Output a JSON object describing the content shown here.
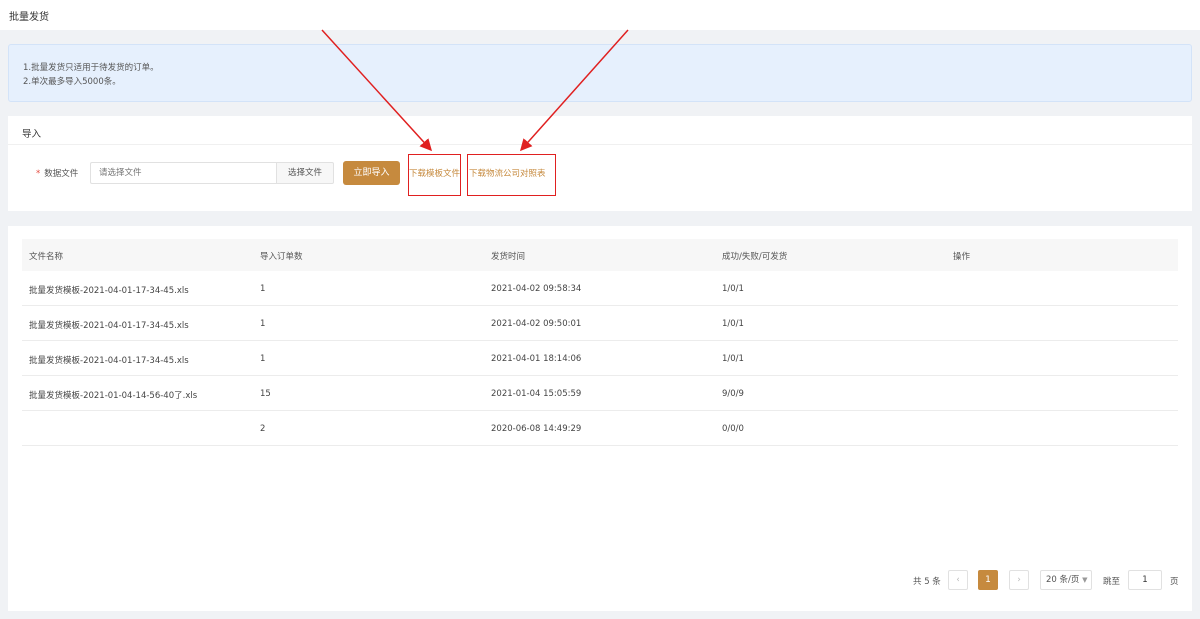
{
  "header": {
    "title": "批量发货"
  },
  "notice": {
    "lines": [
      "1.批量发货只适用于待发货的订单。",
      "2.单次最多导入5000条。"
    ]
  },
  "import": {
    "section_title": "导入",
    "required_mark": "*",
    "file_label": "数据文件",
    "file_placeholder": "请选择文件",
    "choose_file_label": "选择文件",
    "import_button_label": "立即导入",
    "download_template_label": "下载模板文件",
    "download_logistics_label": "下载物流公司对照表"
  },
  "table": {
    "headers": [
      "文件名称",
      "导入订单数",
      "发货时间",
      "成功/失败/可发货",
      "操作"
    ],
    "rows": [
      [
        "批量发货模板-2021-04-01-17-34-45.xls",
        "1",
        "2021-04-02 09:58:34",
        "1/0/1",
        ""
      ],
      [
        "批量发货模板-2021-04-01-17-34-45.xls",
        "1",
        "2021-04-02 09:50:01",
        "1/0/1",
        ""
      ],
      [
        "批量发货模板-2021-04-01-17-34-45.xls",
        "1",
        "2021-04-01 18:14:06",
        "1/0/1",
        ""
      ],
      [
        "批量发货模板-2021-01-04-14-56-40了.xls",
        "15",
        "2021-01-04 15:05:59",
        "9/0/9",
        ""
      ],
      [
        "",
        "2",
        "2020-06-08 14:49:29",
        "0/0/0",
        ""
      ]
    ]
  },
  "pagination": {
    "total_label": "共 5 条",
    "prev_icon": "‹",
    "current_page": "1",
    "next_icon": "›",
    "page_size_label": "20 条/页",
    "page_size_icon": "chevron-down",
    "jump_label": "跳至",
    "jump_value": "1",
    "page_label": "页"
  },
  "annotation_color": "#e02020",
  "accent_color": "#c68a3e"
}
